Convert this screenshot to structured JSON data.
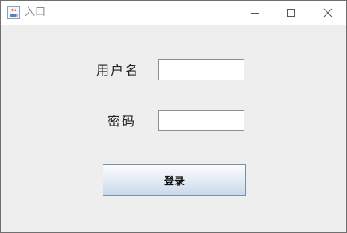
{
  "window": {
    "title": "入口",
    "icon": "java-cup-icon"
  },
  "controls": {
    "minimize": "minimize-icon",
    "maximize": "maximize-icon",
    "close": "close-icon"
  },
  "form": {
    "username_label": "用户名",
    "username_value": "",
    "password_label": "密码",
    "password_value": "",
    "login_label": "登录"
  },
  "colors": {
    "background": "#eeeeee",
    "titlebar": "#ffffff",
    "button_border": "#7a8ea8"
  }
}
